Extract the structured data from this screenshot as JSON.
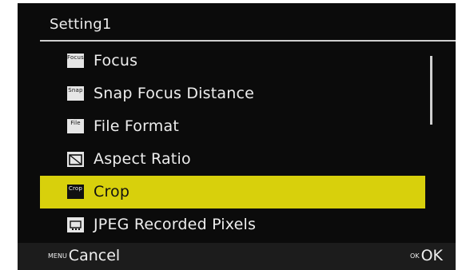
{
  "header": {
    "title": "Setting1"
  },
  "menu": {
    "items": [
      {
        "label": "Focus",
        "icon": "focus-mode-icon",
        "icon_text": "Focus"
      },
      {
        "label": "Snap Focus Distance",
        "icon": "snap-focus-icon",
        "icon_text": "Snap"
      },
      {
        "label": "File Format",
        "icon": "file-format-icon",
        "icon_text": "File"
      },
      {
        "label": "Aspect Ratio",
        "icon": "aspect-ratio-icon",
        "icon_text": ""
      },
      {
        "label": "Crop",
        "icon": "crop-icon",
        "icon_text": "Crop",
        "selected": true
      },
      {
        "label": "JPEG Recorded Pixels",
        "icon": "jpeg-pixels-icon",
        "icon_text": ""
      }
    ]
  },
  "footer": {
    "cancel_key": "MENU",
    "cancel_label": "Cancel",
    "ok_key": "OK",
    "ok_label": "OK"
  },
  "colors": {
    "background": "#0b0b0b",
    "highlight": "#d8d00c",
    "text": "#ededed"
  }
}
